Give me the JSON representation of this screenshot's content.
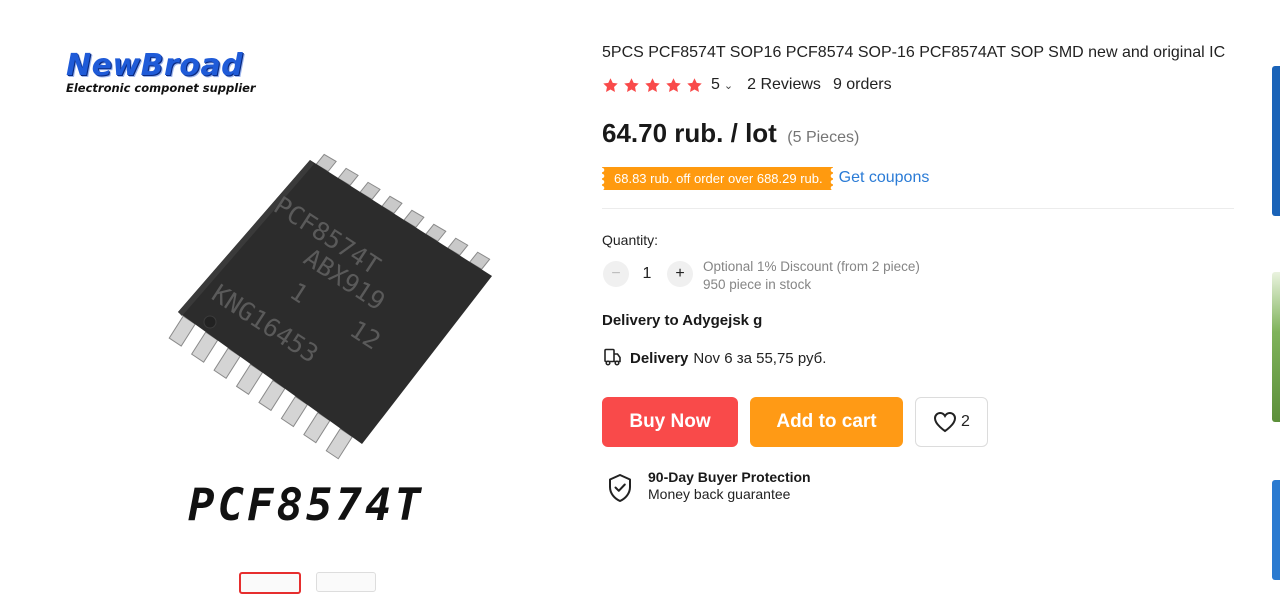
{
  "gallery": {
    "brand": {
      "name": "NewBroad",
      "tagline": "Electronic componet supplier"
    },
    "chip_markings": [
      "PCF8574T",
      "ABX919",
      "1",
      "12",
      "KNG16453"
    ],
    "caption": "PCF8574T"
  },
  "product": {
    "title": "5PCS PCF8574T SOP16 PCF8574 SOP-16 PCF8574AT SOP SMD new and original IC",
    "rating": {
      "stars": 5,
      "value": "5",
      "reviews": "2 Reviews",
      "orders": "9 orders"
    },
    "price": "64.70 rub. / lot",
    "price_qty": "(5 Pieces)",
    "coupon": {
      "badge": "68.83 rub. off order over 688.29 rub.",
      "link": "Get coupons"
    },
    "quantity": {
      "label": "Quantity:",
      "value": "1",
      "minus": "−",
      "plus": "+",
      "discount_note": "Optional 1% Discount (from 2 piece)",
      "stock_note": "950 piece in stock"
    },
    "delivery": {
      "to": "Delivery to Adygejsk g",
      "label": "Delivery",
      "detail": "Nov 6 за 55,75 руб."
    },
    "actions": {
      "buy_now": "Buy Now",
      "add_to_cart": "Add to cart",
      "wishlist_count": "2"
    },
    "protection": {
      "title": "90-Day Buyer Protection",
      "subtitle": "Money back guarantee"
    }
  },
  "colors": {
    "star": "#f94a4a",
    "buy_now": "#f94a4a",
    "add_to_cart": "#ff9a15",
    "coupon_badge": "#ff9a0f",
    "link": "#2a7bd6",
    "brand": "#1f5bd8"
  },
  "icons": [
    "star-icon",
    "chevron-down-icon",
    "minus-icon",
    "plus-icon",
    "truck-icon",
    "heart-icon",
    "shield-check-icon"
  ]
}
